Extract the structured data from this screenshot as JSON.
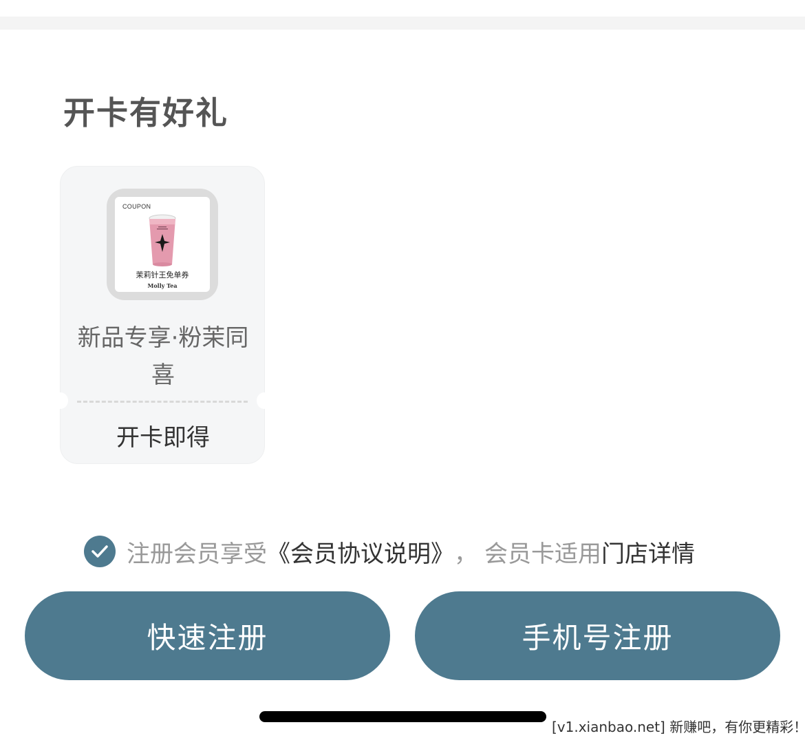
{
  "section": {
    "title": "开卡有好礼"
  },
  "coupon": {
    "image_tag": "COUPON",
    "image_voucher_name": "茉莉针王免单券",
    "image_brand": "Molly Tea",
    "name": "新品专享·粉茉同喜",
    "footer": "开卡即得"
  },
  "agreement": {
    "checked": true,
    "prefix": "注册会员享受",
    "link1": "《会员协议说明》",
    "sep": "，",
    "middle": "会员卡适用",
    "link2": "门店详情"
  },
  "buttons": {
    "quick_register": "快速注册",
    "phone_register": "手机号注册"
  },
  "watermark": "[v1.xianbao.net] 新赚吧，有你更精彩！",
  "colors": {
    "accent": "#4e7a8f",
    "title": "#555555",
    "muted": "#999999",
    "card_bg": "#f5f6f7"
  },
  "icons": [
    "check-icon",
    "tea-cup-icon"
  ]
}
